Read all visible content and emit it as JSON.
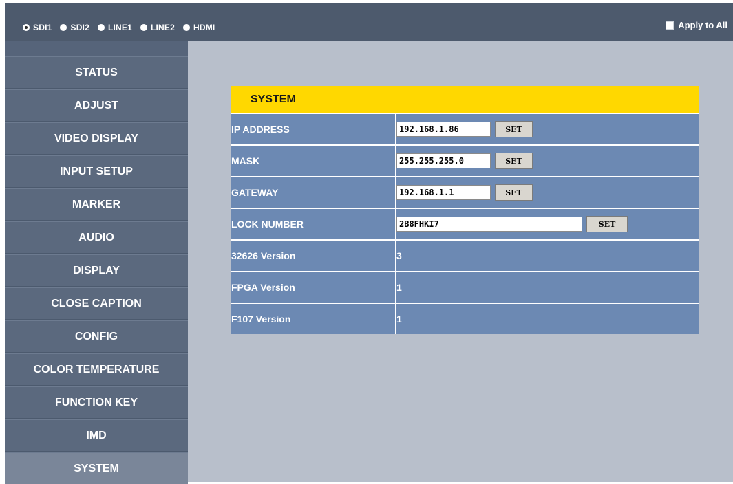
{
  "header": {
    "inputs": [
      {
        "label": "SDI1",
        "checked": true
      },
      {
        "label": "SDI2",
        "checked": false
      },
      {
        "label": "LINE1",
        "checked": false
      },
      {
        "label": "LINE2",
        "checked": false
      },
      {
        "label": "HDMI",
        "checked": false
      }
    ],
    "apply_all_label": "Apply to All"
  },
  "sidebar": {
    "items": [
      {
        "label": "STATUS"
      },
      {
        "label": "ADJUST"
      },
      {
        "label": "VIDEO DISPLAY"
      },
      {
        "label": "INPUT SETUP"
      },
      {
        "label": "MARKER"
      },
      {
        "label": "AUDIO"
      },
      {
        "label": "DISPLAY"
      },
      {
        "label": "CLOSE CAPTION"
      },
      {
        "label": "CONFIG"
      },
      {
        "label": "COLOR TEMPERATURE"
      },
      {
        "label": "FUNCTION KEY"
      },
      {
        "label": "IMD"
      },
      {
        "label": "SYSTEM"
      }
    ],
    "active": "SYSTEM"
  },
  "system": {
    "title": "SYSTEM",
    "set_label": "SET",
    "ip_address": {
      "label": "IP ADDRESS",
      "value": "192.168.1.86"
    },
    "mask": {
      "label": "MASK",
      "value": "255.255.255.0"
    },
    "gateway": {
      "label": "GATEWAY",
      "value": "192.168.1.1"
    },
    "lock_number": {
      "label": "LOCK NUMBER",
      "value": "2B8FHKI7"
    },
    "v32626": {
      "label": "32626 Version",
      "value": "3"
    },
    "fpga": {
      "label": "FPGA Version",
      "value": "1"
    },
    "f107": {
      "label": "F107 Version",
      "value": "1"
    }
  },
  "colors": {
    "topbar": "#4d5a6d",
    "sidebar": "#5b697e",
    "sidebar_active": "#7a8699",
    "main_bg": "#b8bfcb",
    "panel_header": "#ffd800",
    "table_row": "#6c89b3"
  }
}
